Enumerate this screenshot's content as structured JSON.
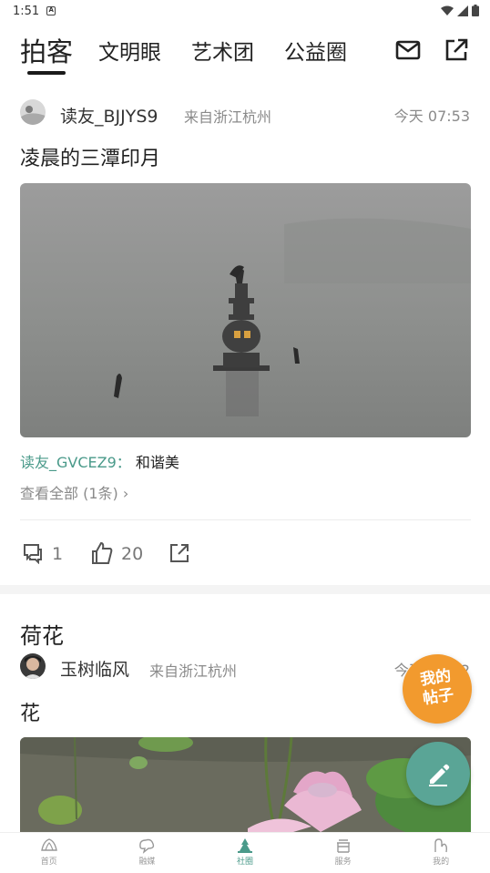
{
  "status_bar": {
    "time": "1:51"
  },
  "tabs": [
    {
      "label": "拍客",
      "active": true
    },
    {
      "label": "文明眼",
      "active": false
    },
    {
      "label": "艺术团",
      "active": false
    },
    {
      "label": "公益圈",
      "active": false
    }
  ],
  "posts": [
    {
      "user": "读友_BJJYS9",
      "location": "来自浙江杭州",
      "time": "今天 07:53",
      "title": "凌晨的三潭印月",
      "comment_user": "读友_GVCEZ9：",
      "comment_text": "和谐美",
      "view_all": "查看全部 (1条)",
      "comments_count": "1",
      "likes_count": "20"
    },
    {
      "heading": "荷花",
      "user": "玉树临风",
      "location": "来自浙江杭州",
      "time": "今天 07:52",
      "title": "花"
    }
  ],
  "fab": {
    "mine_line1": "我的",
    "mine_line2": "帖子"
  },
  "bottom_nav": [
    {
      "label": "首页",
      "icon": "home-icon"
    },
    {
      "label": "融媒",
      "icon": "media-icon"
    },
    {
      "label": "社圈",
      "icon": "community-icon",
      "active": true
    },
    {
      "label": "服务",
      "icon": "service-icon"
    },
    {
      "label": "我的",
      "icon": "profile-icon"
    }
  ],
  "colors": {
    "accent": "#4a9a8a",
    "fab_orange": "#f29a2e",
    "fab_green": "#5aa596"
  }
}
